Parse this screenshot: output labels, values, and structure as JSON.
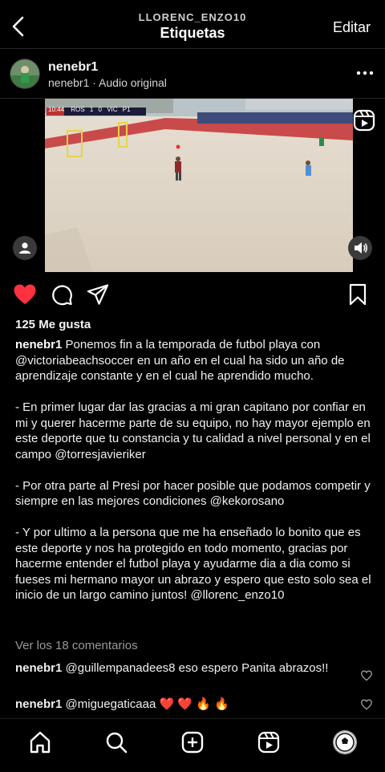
{
  "header": {
    "subtitle": "LLORENC_ENZO10",
    "title": "Etiquetas",
    "edit_label": "Editar"
  },
  "post": {
    "username": "nenebr1",
    "audio": "nenebr1 · Audio original",
    "scoreboard": {
      "time": "10:44",
      "home": "ROS",
      "home_score": "1",
      "away_score": "0",
      "away": "VIC",
      "period": "P1"
    },
    "likes": "125 Me gusta",
    "caption": {
      "author": "nenebr1",
      "p1": " Ponemos fin a la temporada de futbol playa con @victoriabeachsoccer en un año en el cual ha sido un año de aprendizaje constante y en el cual he aprendido mucho.",
      "p2": "- En primer lugar dar las gracias a mi gran capitano por confiar en mi y querer hacerme parte de su equipo, no hay mayor ejemplo en este deporte que tu constancia y tu calidad a nivel personal y en el campo @torresjavieriker",
      "p3": "- Por otra parte al Presi por hacer posible que podamos competir y siempre en las mejores condiciones @kekorosano",
      "p4": "- Y por ultimo a la persona que me ha enseñado lo bonito que es este deporte y nos ha protegido en todo momento, gracias por hacerme entender el futbol playa y ayudarme dia a dia como si fueses mi hermano mayor un abrazo y espero que esto solo sea el inicio de un largo camino juntos! @llorenc_enzo10"
    },
    "view_comments": "Ver los 18 comentarios",
    "comments": [
      {
        "user": "nenebr1",
        "text": " @guillempanadees8 eso espero Panita abrazos!!"
      },
      {
        "user": "nenebr1",
        "text": " @miguegaticaaa ❤️ ❤️ 🔥 🔥"
      }
    ],
    "liked": true,
    "accent_like": "#ff3040"
  },
  "icons": [
    "back-icon",
    "more-icon",
    "reels-badge-icon",
    "person-icon",
    "sound-icon",
    "heart-icon",
    "comment-icon",
    "share-icon",
    "bookmark-icon",
    "home-icon",
    "search-icon",
    "create-icon",
    "reels-icon"
  ]
}
